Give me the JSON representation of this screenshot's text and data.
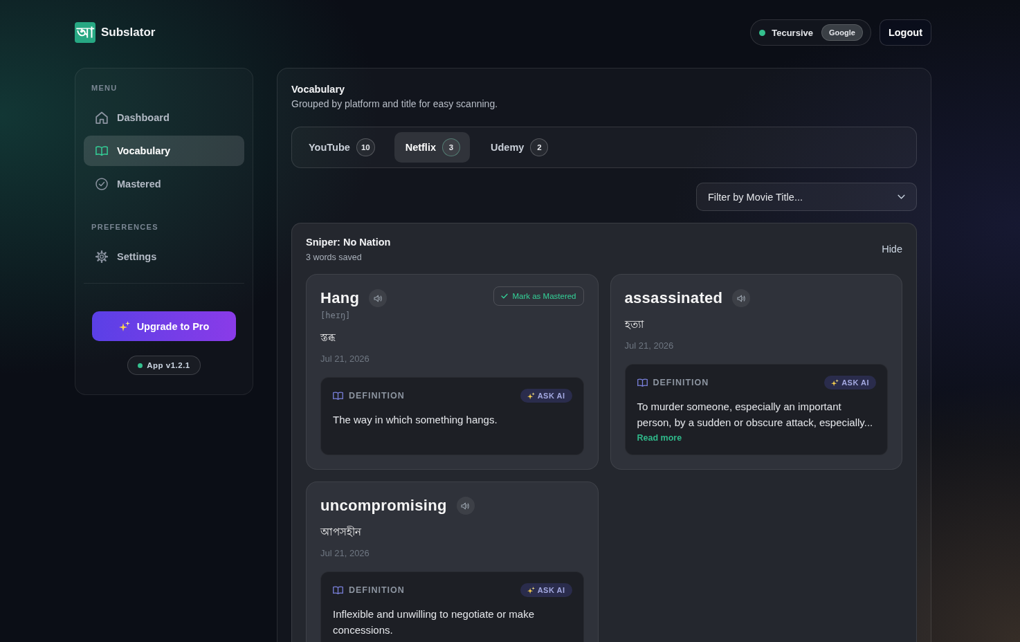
{
  "header": {
    "logo": {
      "glyph": "আ",
      "name": "Subslator"
    },
    "account": {
      "user": "Tecursive",
      "provider": "Google"
    },
    "logout_button": "Logout"
  },
  "sidebar": {
    "sections": [
      {
        "label": "MENU",
        "items": [
          {
            "label": "Dashboard",
            "kind": "home",
            "selected": false
          },
          {
            "label": "Vocabulary",
            "kind": "book",
            "selected": true
          },
          {
            "label": "Mastered",
            "kind": "check",
            "selected": false
          }
        ]
      },
      {
        "label": "PREFERENCES",
        "items": [
          {
            "label": "Settings",
            "kind": "gear",
            "selected": false
          }
        ]
      }
    ],
    "upgrade_button": "Upgrade to Pro",
    "version": "App v1.2.1"
  },
  "vocabulary": {
    "title": "Vocabulary",
    "subtitle": "Grouped by platform and title for easy scanning.",
    "platform_tabs": [
      {
        "label": "YouTube",
        "count": "10",
        "selected": false
      },
      {
        "label": "Netflix",
        "count": "3",
        "selected": true
      },
      {
        "label": "Udemy",
        "count": "2",
        "selected": false
      }
    ],
    "movie_filter": {
      "value": "Filter by Movie Title..."
    },
    "groups": [
      {
        "title": "Sniper: No Nation",
        "count_text": "3 words saved",
        "hide_button": "Hide",
        "words": [
          {
            "word": "Hang",
            "phonetic": "[heɪŋ]",
            "translation": "স্তব্ধ",
            "date": "Jul 21, 2026",
            "mastered_button": "Mark as Mastered",
            "definition_label": "DEFINITION",
            "ask_ai": "ASK AI",
            "definition": "The way in which something hangs."
          },
          {
            "word": "assassinated",
            "translation": "হত্যা",
            "date": "Jul 21, 2026",
            "definition_label": "DEFINITION",
            "ask_ai": "ASK AI",
            "definition": "To murder someone, especially an important person, by a sudden or obscure attack, especially...",
            "read_more": "Read more"
          },
          {
            "word": "uncompromising",
            "translation": "আপসহীন",
            "date": "Jul 21, 2026",
            "definition_label": "DEFINITION",
            "ask_ai": "ASK AI",
            "definition": "Inflexible and unwilling to negotiate or make concessions."
          }
        ]
      }
    ]
  }
}
